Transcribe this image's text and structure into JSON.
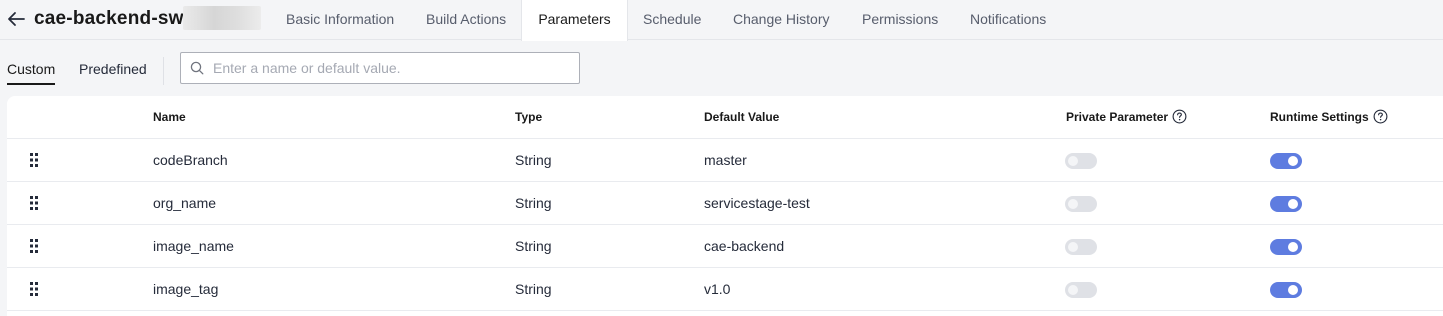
{
  "header": {
    "title": "cae-backend-swr",
    "tabs": [
      {
        "label": "Basic Information",
        "active": false
      },
      {
        "label": "Build Actions",
        "active": false
      },
      {
        "label": "Parameters",
        "active": true
      },
      {
        "label": "Schedule",
        "active": false
      },
      {
        "label": "Change History",
        "active": false
      },
      {
        "label": "Permissions",
        "active": false
      },
      {
        "label": "Notifications",
        "active": false
      }
    ]
  },
  "subtabs": [
    {
      "label": "Custom",
      "active": true
    },
    {
      "label": "Predefined",
      "active": false
    }
  ],
  "search": {
    "placeholder": "Enter a name or default value.",
    "value": ""
  },
  "table": {
    "columns": {
      "name": "Name",
      "type": "Type",
      "default_value": "Default Value",
      "private_parameter": "Private Parameter",
      "runtime_settings": "Runtime Settings"
    },
    "rows": [
      {
        "name": "codeBranch",
        "type": "String",
        "default_value": "master",
        "private": false,
        "runtime": true
      },
      {
        "name": "org_name",
        "type": "String",
        "default_value": "servicestage-test",
        "private": false,
        "runtime": true
      },
      {
        "name": "image_name",
        "type": "String",
        "default_value": "cae-backend",
        "private": false,
        "runtime": true
      },
      {
        "name": "image_tag",
        "type": "String",
        "default_value": "v1.0",
        "private": false,
        "runtime": true
      }
    ]
  },
  "colors": {
    "accent": "#5e7ce0",
    "toggle_off": "#dfe1e6",
    "background": "#f4f5f7"
  },
  "icons": {
    "back": "arrow-left-icon",
    "search": "search-icon",
    "help": "question-circle-icon",
    "drag": "drag-handle-icon"
  }
}
